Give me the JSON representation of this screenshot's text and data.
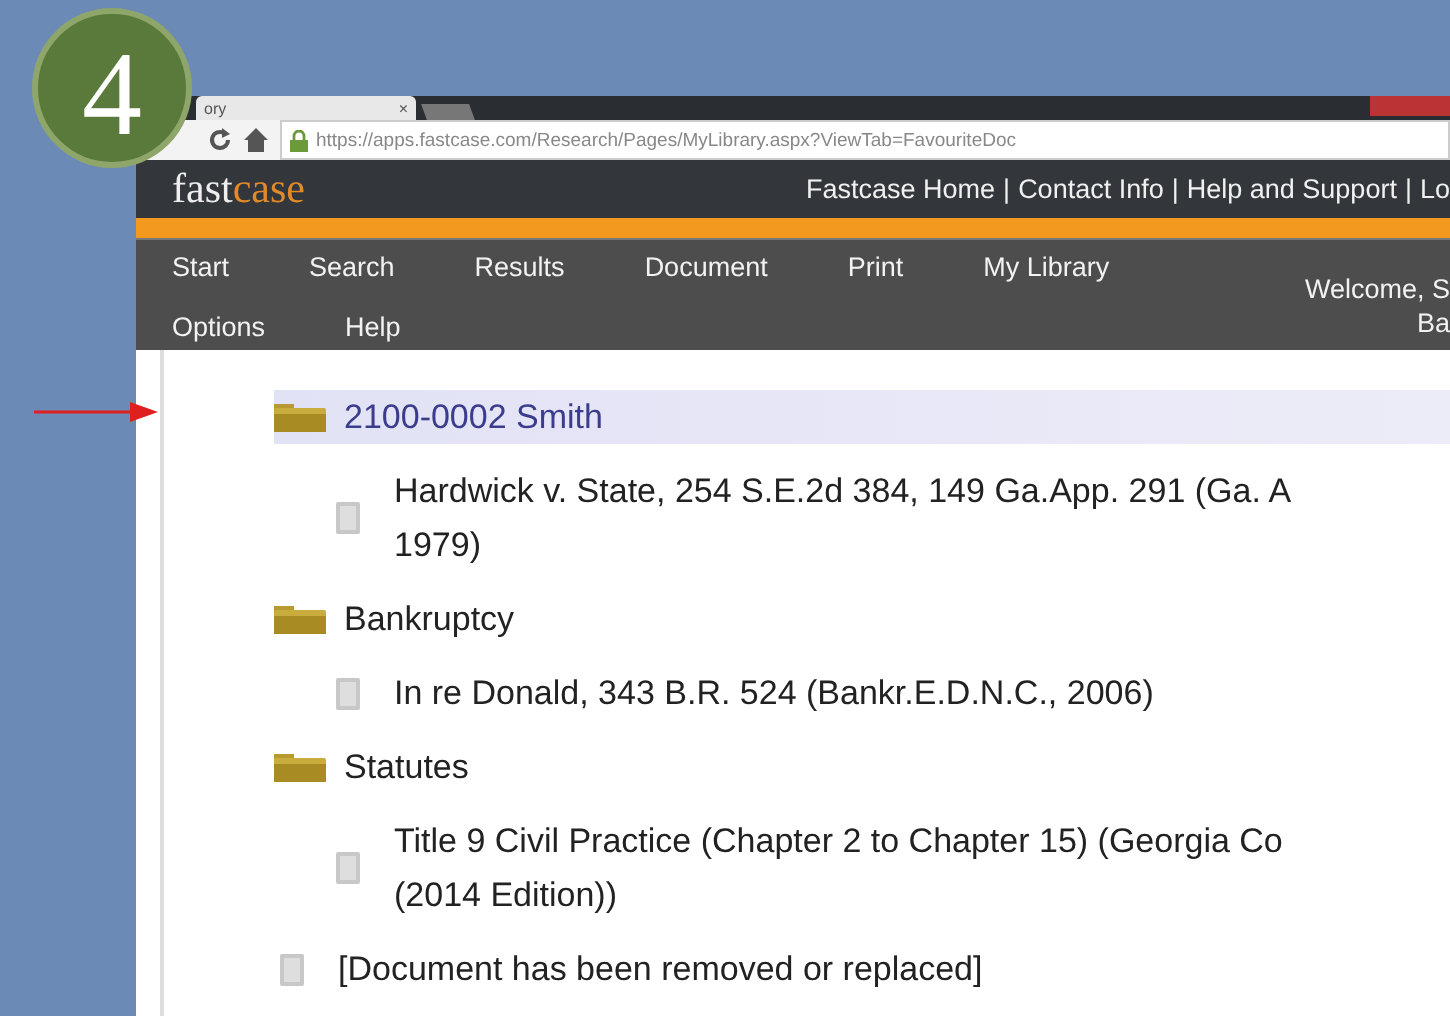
{
  "step_badge": "4",
  "browser": {
    "tab_title": "ory",
    "tab_close": "×",
    "url": "https://apps.fastcase.com/Research/Pages/MyLibrary.aspx?ViewTab=FavouriteDoc"
  },
  "header": {
    "logo_parts": [
      "fast",
      "case"
    ],
    "links": [
      {
        "label": "Fastcase Home",
        "separator": "|"
      },
      {
        "label": "Contact Info",
        "separator": "|"
      },
      {
        "label": "Help and Support",
        "separator": "|"
      },
      {
        "label": "Lo"
      }
    ]
  },
  "nav": {
    "rows": [
      [
        "Start",
        "Search",
        "Results",
        "Document",
        "Print",
        "My Library"
      ],
      [
        "Options",
        "Help"
      ]
    ],
    "welcome_lines": [
      "Welcome, S",
      "Ba"
    ]
  },
  "tree": [
    {
      "kind": "folder",
      "lines": [
        "2100-0002 Smith"
      ],
      "selected": true,
      "annotated": true,
      "children": [
        {
          "kind": "document",
          "lines": [
            "Hardwick v. State, 254 S.E.2d 384, 149 Ga.App. 291 (Ga. A",
            "1979)"
          ],
          "selected": false
        }
      ]
    },
    {
      "kind": "folder",
      "lines": [
        "Bankruptcy"
      ],
      "selected": false,
      "annotated": false,
      "children": [
        {
          "kind": "document",
          "lines": [
            "In re Donald, 343 B.R. 524 (Bankr.E.D.N.C., 2006)"
          ],
          "selected": false
        }
      ]
    },
    {
      "kind": "folder",
      "lines": [
        "Statutes"
      ],
      "selected": false,
      "annotated": false,
      "children": [
        {
          "kind": "document",
          "lines": [
            "Title 9 Civil Practice (Chapter 2 to Chapter 15) (Georgia Co",
            "(2014 Edition))"
          ],
          "selected": false
        }
      ]
    },
    {
      "kind": "document",
      "lines": [
        "[Document has been removed or replaced]"
      ],
      "selected": false
    }
  ]
}
